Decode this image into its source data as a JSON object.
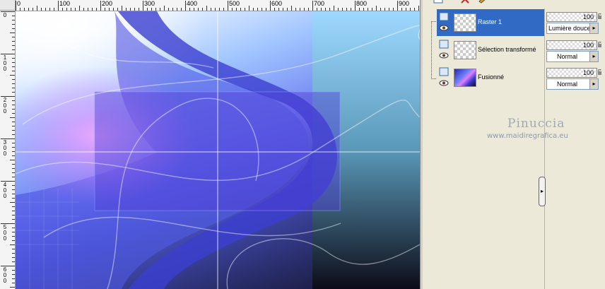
{
  "ruler": {
    "top_labels": [
      "0",
      "100",
      "200",
      "300",
      "400",
      "500",
      "600",
      "700",
      "800",
      "900"
    ],
    "left_labels": [
      "0",
      "1\n0\n0",
      "2\n0\n0",
      "3\n0\n0",
      "4\n0\n0",
      "5\n0\n0",
      "6\n0\n0"
    ]
  },
  "layers": [
    {
      "name": "Raster 1",
      "selected": true,
      "thumb": "transparent",
      "opacity": "100",
      "blend": "Lumière douce"
    },
    {
      "name": "Sélection transformé",
      "selected": false,
      "thumb": "transparent",
      "opacity": "100",
      "blend": "Normal"
    },
    {
      "name": "Fusionné",
      "selected": false,
      "thumb": "photo",
      "opacity": "100",
      "blend": "Normal"
    }
  ],
  "watermark": {
    "name": "Pinuccia",
    "url": "www.maidiregrafica.eu"
  },
  "icons": {
    "eye": "eye-icon",
    "raster": "raster-layer-icon",
    "delete": "delete-layer-icon",
    "new": "new-layer-icon",
    "lock": "lock-icon",
    "dropdown": "dropdown-arrow-icon",
    "collapse": "collapse-panel-icon"
  }
}
